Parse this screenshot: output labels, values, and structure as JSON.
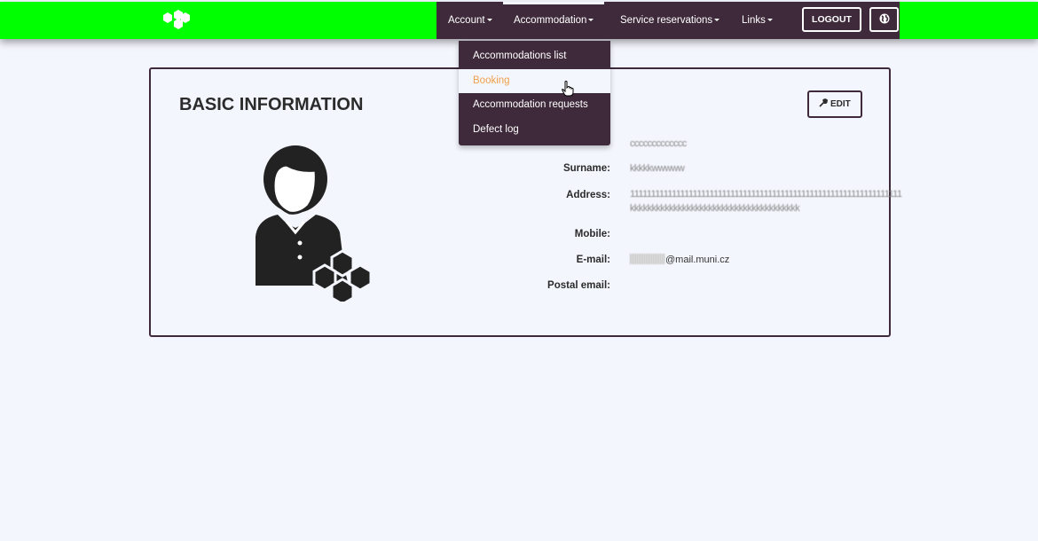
{
  "nav": {
    "account": "Account",
    "accommodation": "Accommodation",
    "service_reservations": "Service reservations",
    "links": "Links",
    "logout": "LOGOUT",
    "language_icon": "globe-icon"
  },
  "dropdown": {
    "items": [
      {
        "label": "Accommodations list"
      },
      {
        "label": "Booking"
      },
      {
        "label": "Accommodation requests"
      },
      {
        "label": "Defect log"
      }
    ]
  },
  "card": {
    "title": "BASIC INFORMATION",
    "edit_label": "EDIT",
    "fields": {
      "name_value": "ccccccccccccc",
      "surname_label": "Surname:",
      "surname_value": "kkkkkwwwww",
      "address_label": "Address:",
      "address_value_1": "11111111111111111111111111111111111111111111111111111111111111111",
      "address_value_2": "kkkkkkkkkkkkkkkkkkkkkkkkkkkkkkkkkkkkkkk",
      "mobile_label": "Mobile:",
      "email_label": "E-mail:",
      "email_value": "@mail.muni.cz",
      "postal_email_label": "Postal email:"
    }
  },
  "colors": {
    "topbar": "#00ff00",
    "nav_bg": "#3f2a3b",
    "page_bg": "#f4f6fd",
    "hover_text": "#f0a04b"
  }
}
